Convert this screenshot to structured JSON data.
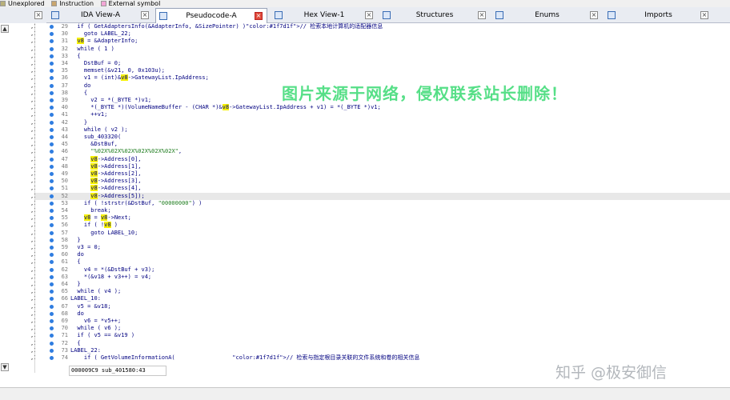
{
  "legend": [
    {
      "label": "Unexplored",
      "color": "#b8b07a"
    },
    {
      "label": "Instruction",
      "color": "#c9a56e"
    },
    {
      "label": "External symbol",
      "color": "#f2a6d6"
    }
  ],
  "tabs": [
    {
      "label": "",
      "icon": "view-icon"
    },
    {
      "label": "IDA View-A",
      "icon": "ida-view-icon"
    },
    {
      "label": "Pseudocode-A",
      "icon": "pseudocode-icon",
      "active": true
    },
    {
      "label": "Hex View-1",
      "icon": "hex-view-icon"
    },
    {
      "label": "Structures",
      "icon": "structures-icon"
    },
    {
      "label": "Enums",
      "icon": "enums-icon"
    },
    {
      "label": "Imports",
      "icon": "imports-icon"
    }
  ],
  "code_lines": [
    {
      "n": "29",
      "t": "  if ( GetAdaptersInfo(&AdapterInfo, &SizePointer) )// 检索本地计算机的适配器信息"
    },
    {
      "n": "30",
      "t": "    goto LABEL_22;"
    },
    {
      "n": "31",
      "t": "  v8 = &AdapterInfo;"
    },
    {
      "n": "32",
      "t": "  while ( 1 )"
    },
    {
      "n": "33",
      "t": "  {"
    },
    {
      "n": "34",
      "t": "    DstBuf = 0;"
    },
    {
      "n": "35",
      "t": "    memset(&v21, 0, 0x103u);"
    },
    {
      "n": "36",
      "t": "    v1 = (int)&v8->GatewayList.IpAddress;"
    },
    {
      "n": "37",
      "t": "    do"
    },
    {
      "n": "38",
      "t": "    {"
    },
    {
      "n": "39",
      "t": "      v2 = *(_BYTE *)v1;"
    },
    {
      "n": "40",
      "t": "      *(_BYTE *)(VolumeNameBuffer - (CHAR *)&v8->GatewayList.IpAddress + v1) = *(_BYTE *)v1;"
    },
    {
      "n": "41",
      "t": "      ++v1;"
    },
    {
      "n": "42",
      "t": "    }"
    },
    {
      "n": "43",
      "t": "    while ( v2 );"
    },
    {
      "n": "44",
      "t": "    sub_403320("
    },
    {
      "n": "45",
      "t": "      &DstBuf,"
    },
    {
      "n": "46",
      "t": "      \"%02X%02X%02X%02X%02X%02X\","
    },
    {
      "n": "47",
      "t": "      v8->Address[0],"
    },
    {
      "n": "48",
      "t": "      v8->Address[1],"
    },
    {
      "n": "49",
      "t": "      v8->Address[2],"
    },
    {
      "n": "50",
      "t": "      v8->Address[3],"
    },
    {
      "n": "51",
      "t": "      v8->Address[4],"
    },
    {
      "n": "52",
      "t": "      v8->Address[5]);"
    },
    {
      "n": "53",
      "t": "    if ( !strstr(&DstBuf, \"00000000\") )"
    },
    {
      "n": "54",
      "t": "      break;"
    },
    {
      "n": "55",
      "t": "    v8 = v8->Next;"
    },
    {
      "n": "56",
      "t": "    if ( !v8 )"
    },
    {
      "n": "57",
      "t": "      goto LABEL_10;"
    },
    {
      "n": "58",
      "t": "  }"
    },
    {
      "n": "59",
      "t": "  v3 = 0;"
    },
    {
      "n": "60",
      "t": "  do"
    },
    {
      "n": "61",
      "t": "  {"
    },
    {
      "n": "62",
      "t": "    v4 = *(&DstBuf + v3);"
    },
    {
      "n": "63",
      "t": "    *(&v18 + v3++) = v4;"
    },
    {
      "n": "64",
      "t": "  }"
    },
    {
      "n": "65",
      "t": "  while ( v4 );"
    },
    {
      "n": "66",
      "t": "LABEL_10:"
    },
    {
      "n": "67",
      "t": "  v5 = &v18;"
    },
    {
      "n": "68",
      "t": "  do"
    },
    {
      "n": "69",
      "t": "    v6 = *v5++;"
    },
    {
      "n": "70",
      "t": "  while ( v6 );"
    },
    {
      "n": "71",
      "t": "  if ( v5 == &v19 )"
    },
    {
      "n": "72",
      "t": "  {"
    },
    {
      "n": "73",
      "t": "LABEL_22:"
    },
    {
      "n": "74",
      "t": "    if ( GetVolumeInformationA(                 // 检索与指定根目录关联的文件系统和卷的相关信息"
    }
  ],
  "highlight_token": "v8",
  "watermark_center": "图片来源于网络，侵权联系站长删除！",
  "watermark_footer": "知乎 @极安御信",
  "status_address": "000009C9 sub_401580:43",
  "colors": {
    "keyword": "#000080",
    "comment": "#1f7d1f",
    "string": "#1f7d1f",
    "highlight": "#f5f000",
    "dot": "#2f7de0"
  }
}
